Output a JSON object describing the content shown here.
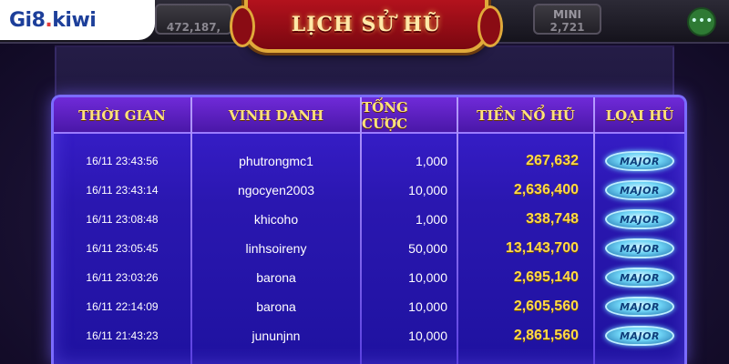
{
  "brand": {
    "logo_main": "Gi8",
    "logo_dot": ".",
    "logo_tld": "kiwi"
  },
  "background": {
    "jackpot_left_value": "472,187,",
    "jackpot_right_label": "MINI",
    "jackpot_right_value": "2,721"
  },
  "title": "LỊCH SỬ HŨ",
  "table": {
    "headers": {
      "time": "THỜI GIAN",
      "honor": "VINH DANH",
      "total_bet": "TỔNG CƯỢC",
      "jackpot_win": "TIỀN NỔ HŨ",
      "jackpot_type": "LOẠI HŨ"
    },
    "rows": [
      {
        "time": "16/11 23:43:56",
        "name": "phutrongmc1",
        "bet": "1,000",
        "win": "267,632",
        "type": "MAJOR"
      },
      {
        "time": "16/11 23:43:14",
        "name": "ngocyen2003",
        "bet": "10,000",
        "win": "2,636,400",
        "type": "MAJOR"
      },
      {
        "time": "16/11 23:08:48",
        "name": "khicoho",
        "bet": "1,000",
        "win": "338,748",
        "type": "MAJOR"
      },
      {
        "time": "16/11 23:05:45",
        "name": "linhsoireny",
        "bet": "50,000",
        "win": "13,143,700",
        "type": "MAJOR"
      },
      {
        "time": "16/11 23:03:26",
        "name": "barona",
        "bet": "10,000",
        "win": "2,695,140",
        "type": "MAJOR"
      },
      {
        "time": "16/11 22:14:09",
        "name": "barona",
        "bet": "10,000",
        "win": "2,605,560",
        "type": "MAJOR"
      },
      {
        "time": "16/11 21:43:23",
        "name": "jununjnn",
        "bet": "10,000",
        "win": "2,861,560",
        "type": "MAJOR"
      }
    ]
  }
}
